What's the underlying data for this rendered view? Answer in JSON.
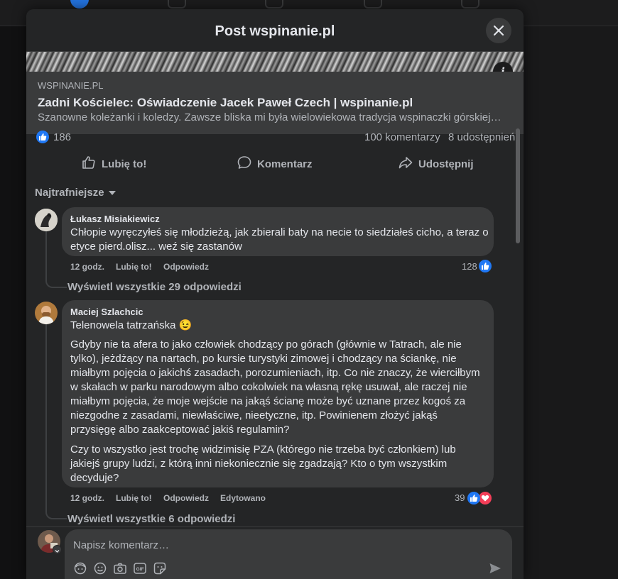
{
  "dialog": {
    "title": "Post wspinanie.pl"
  },
  "link_preview": {
    "domain": "WSPINANIE.PL",
    "title": "Zadni Kościelec: Oświadczenie Jacek Paweł Czech | wspinanie.pl",
    "description": "Szanowne koleżanki i koledzy. Zawsze bliska mi była wielowiekowa tradycja wspinaczki górskiej…"
  },
  "stats": {
    "reactions": "186",
    "comments": "100 komentarzy",
    "shares": "8 udostępnień"
  },
  "actions": {
    "like": "Lubię to!",
    "comment": "Komentarz",
    "share": "Udostępnij"
  },
  "sort": {
    "label": "Najtrafniejsze"
  },
  "comments": [
    {
      "author": "Łukasz Misiakiewicz",
      "paragraphs": [
        "Chłopie wyręczyłeś się młodzieżą, jak zbierali baty na necie to siedziałeś cicho, a teraz o etyce pierd.olisz... weź się zastanów"
      ],
      "time": "12 godz.",
      "like_label": "Lubię to!",
      "reply_label": "Odpowiedz",
      "reaction_count": "128",
      "replies_link": "Wyświetl wszystkie 29 odpowiedzi"
    },
    {
      "author": "Maciej Szlachcic",
      "paragraphs": [
        "Telenowela tatrzańska 😉",
        "Gdyby nie ta afera to jako człowiek chodzący po górach (głównie w Tatrach, ale nie tylko), jeżdżący na nartach, po kursie turystyki zimowej i chodzący na ściankę, nie miałbym pojęcia o jakichś zasadach, porozumieniach, itp. Co nie znaczy, że wierciłbym w skałach w parku narodowym albo cokolwiek na własną rękę usuwał, ale raczej nie miałbym pojęcia, że moje wejście na jakąś ścianę może być uznane przez kogoś za niezgodne z zasadami, niewłaściwe, nieetyczne, itp. Powinienem złożyć jakąś przysięgę albo zaakceptować jakiś regulamin?",
        "Czy to wszystko jest trochę widzimisię PZA (którego nie trzeba być członkiem) lub jakiejś grupy ludzi, z którą inni niekoniecznie się zgadzają? Kto o tym wszystkim decyduje?"
      ],
      "time": "12 godz.",
      "like_label": "Lubię to!",
      "reply_label": "Odpowiedz",
      "edited_label": "Edytowano",
      "reaction_count": "39",
      "replies_link": "Wyświetl wszystkie 6 odpowiedzi"
    }
  ],
  "composer": {
    "placeholder": "Napisz komentarz…",
    "tool_icons": [
      "avatar-sticker-icon",
      "emoji-icon",
      "camera-icon",
      "gif-icon",
      "sticker-icon"
    ]
  },
  "colors": {
    "background": "#242526",
    "bubble": "#3a3b3c",
    "like_blue": "#2078f4",
    "love_red": "#f33e58",
    "secondary_text": "#b0b3b8"
  }
}
